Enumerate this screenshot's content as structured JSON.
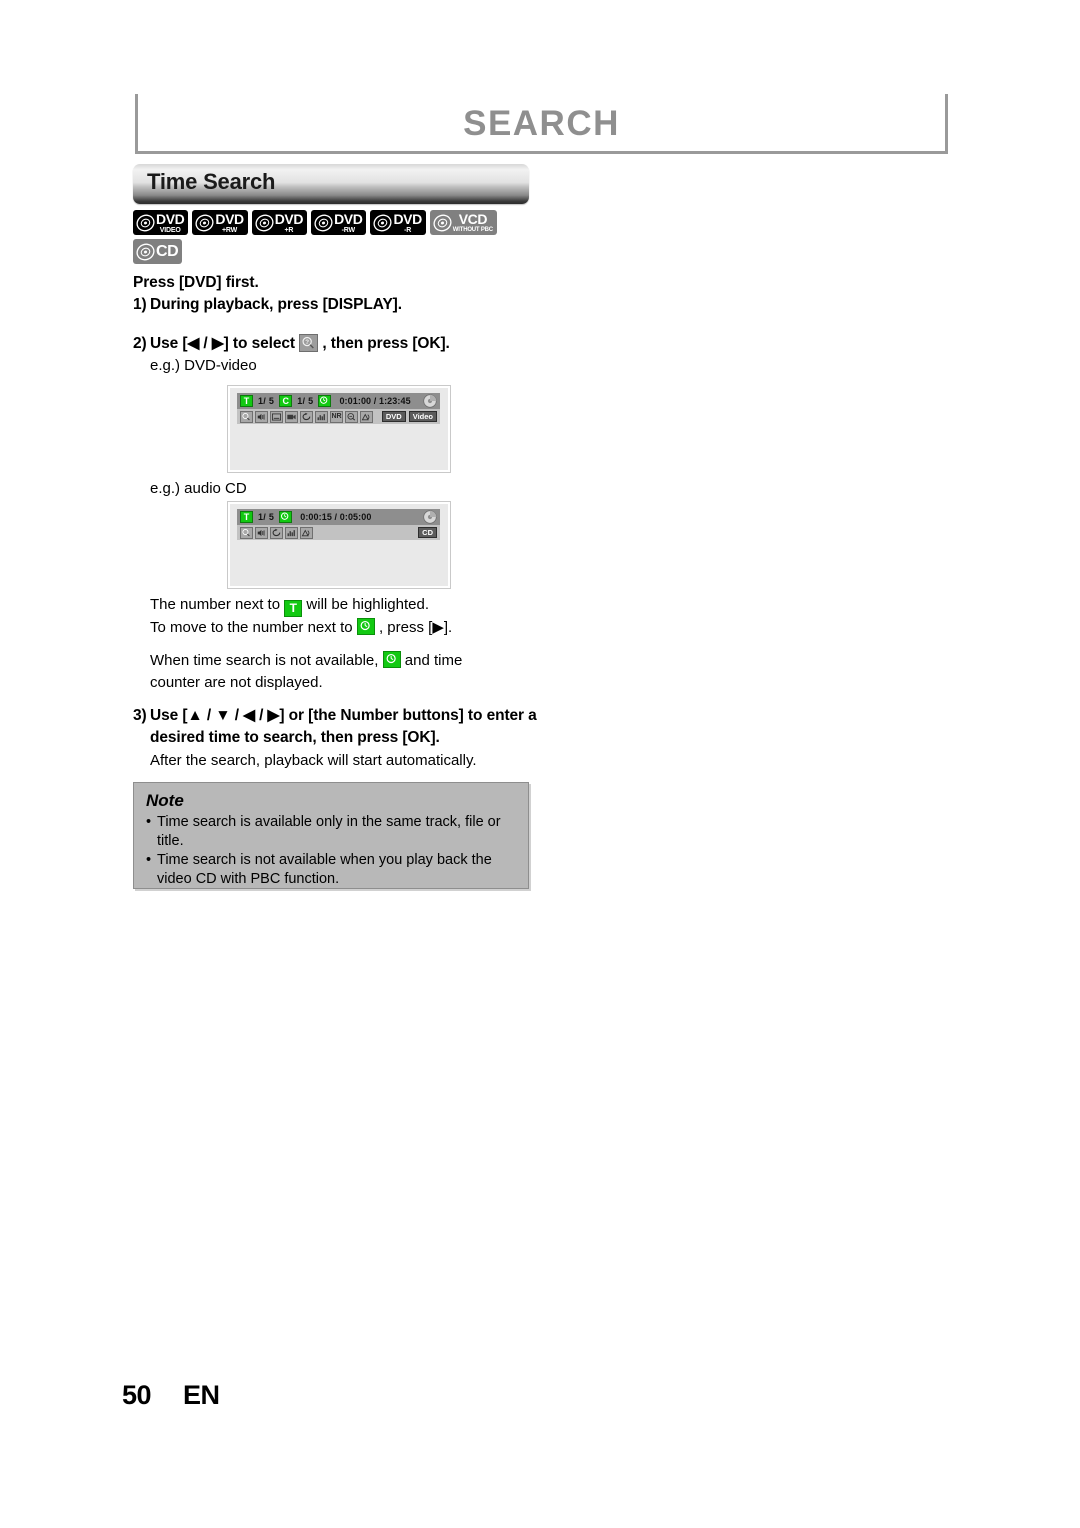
{
  "header": {
    "title": "SEARCH",
    "title_color": "#8f8f8f"
  },
  "section": {
    "title": "Time Search"
  },
  "disc_badges": [
    {
      "main": "DVD",
      "sub": "VIDEO",
      "style": "black",
      "icon": "disc-icon"
    },
    {
      "main": "DVD",
      "sub": "+RW",
      "style": "black",
      "icon": "disc-icon"
    },
    {
      "main": "DVD",
      "sub": "+R",
      "style": "black",
      "icon": "disc-icon"
    },
    {
      "main": "DVD",
      "sub": "-RW",
      "style": "black",
      "icon": "disc-icon"
    },
    {
      "main": "DVD",
      "sub": "-R",
      "style": "black",
      "icon": "disc-icon"
    },
    {
      "main": "VCD",
      "sub": "WITHOUT PBC",
      "style": "gray",
      "icon": "disc-icon"
    },
    {
      "main": "CD",
      "sub": "",
      "style": "gray",
      "icon": "disc-icon"
    }
  ],
  "instructions": {
    "intro": "Press [DVD] first.",
    "step1_num": "1)",
    "step1_text": "During playback, press [DISPLAY].",
    "step2_num": "2)",
    "step2_before": "Use [◀ / ▶] to select",
    "step2_after": ", then press [OK].",
    "example_dvd": "e.g.) DVD-video",
    "example_cd": "e.g.) audio CD",
    "note_line1_before": "The number next to",
    "note_line1_after": "will be highlighted.",
    "note_line2_before": "To move to the number next to",
    "note_line2_after": ", press [▶].",
    "note_line3_before": "When time search is not available,",
    "note_line3_after": "and time",
    "note_line3_cont": "counter are not displayed.",
    "step3_num": "3)",
    "step3_line1": "Use [▲ / ▼ / ◀ / ▶] or [the Number buttons] to",
    "step3_line2": "enter a desired time to search, then press [OK].",
    "step3_sub": "After the search, playback will start automatically."
  },
  "osd_dvd": {
    "title_chip": "T",
    "title_value": "1/  5",
    "chapter_chip": "C",
    "chapter_value": "1/  5",
    "time_chip": "clock-icon",
    "time_value": "0:01:00 / 1:23:45",
    "disc_icon": "disc-progress-icon",
    "icons": [
      "search-icon",
      "audio-icon",
      "subtitle-icon",
      "angle-icon",
      "repeat-icon",
      "equalizer-icon",
      "noise-reduction-icon",
      "zoom-icon",
      "surround-icon"
    ],
    "nr_label": "NR",
    "tags": [
      "DVD",
      "Video"
    ]
  },
  "osd_cd": {
    "title_chip": "T",
    "title_value": "1/  5",
    "time_chip": "clock-icon",
    "time_value": "0:00:15 / 0:05:00",
    "disc_icon": "disc-progress-icon",
    "icons": [
      "search-icon",
      "audio-icon",
      "repeat-icon",
      "equalizer-icon",
      "surround-icon"
    ],
    "tags": [
      "CD"
    ]
  },
  "note": {
    "title": "Note",
    "bullet": "•",
    "items": [
      "Time search is available only in the same track, file or title.",
      "Time search is not available when you play back the video CD with PBC function."
    ]
  },
  "footer": {
    "page": "50",
    "lang": "EN"
  }
}
